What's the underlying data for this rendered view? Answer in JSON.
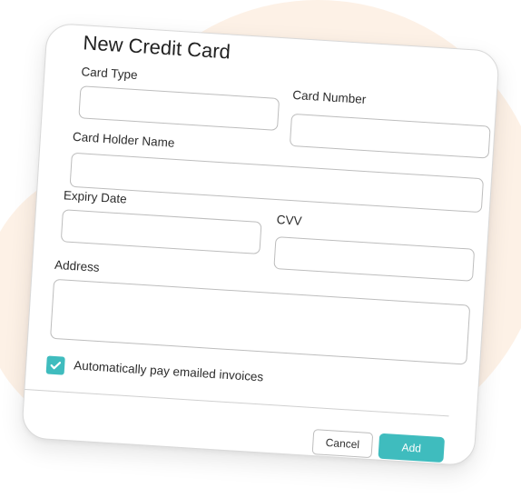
{
  "dialog": {
    "title": "New Credit Card"
  },
  "fields": {
    "card_type": {
      "label": "Card Type",
      "value": ""
    },
    "card_number": {
      "label": "Card Number",
      "value": ""
    },
    "card_holder_name": {
      "label": "Card Holder Name",
      "value": ""
    },
    "expiry_date": {
      "label": "Expiry Date",
      "value": ""
    },
    "cvv": {
      "label": "CVV",
      "value": ""
    },
    "address": {
      "label": "Address",
      "value": ""
    }
  },
  "auto_pay": {
    "label": "Automatically pay emailed invoices",
    "checked": true
  },
  "actions": {
    "cancel_label": "Cancel",
    "add_label": "Add"
  },
  "colors": {
    "accent": "#3fbcbe",
    "background_blob": "#fdf1e6"
  }
}
